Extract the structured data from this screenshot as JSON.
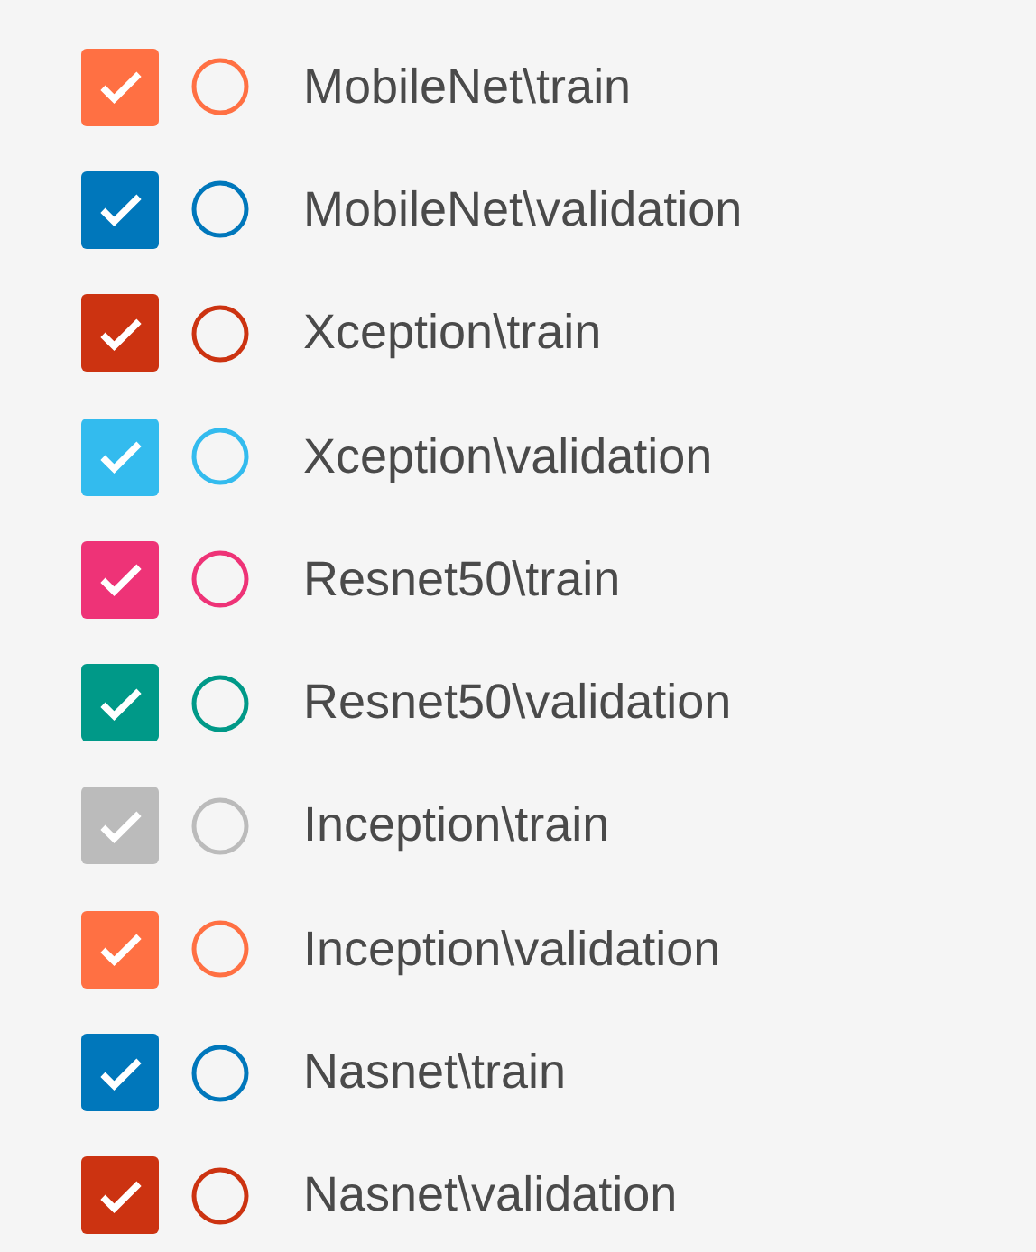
{
  "runs": [
    {
      "label": "MobileNet\\train",
      "checked": true,
      "color": "#ff7043"
    },
    {
      "label": "MobileNet\\validation",
      "checked": true,
      "color": "#0077bb"
    },
    {
      "label": "Xception\\train",
      "checked": true,
      "color": "#cc3311"
    },
    {
      "label": "Xception\\validation",
      "checked": true,
      "color": "#33bbee"
    },
    {
      "label": "Resnet50\\train",
      "checked": true,
      "color": "#ee3377"
    },
    {
      "label": "Resnet50\\validation",
      "checked": true,
      "color": "#009988"
    },
    {
      "label": "Inception\\train",
      "checked": true,
      "color": "#bbbbbb"
    },
    {
      "label": "Inception\\validation",
      "checked": true,
      "color": "#ff7043"
    },
    {
      "label": "Nasnet\\train",
      "checked": true,
      "color": "#0077bb"
    },
    {
      "label": "Nasnet\\validation",
      "checked": true,
      "color": "#cc3311"
    }
  ]
}
